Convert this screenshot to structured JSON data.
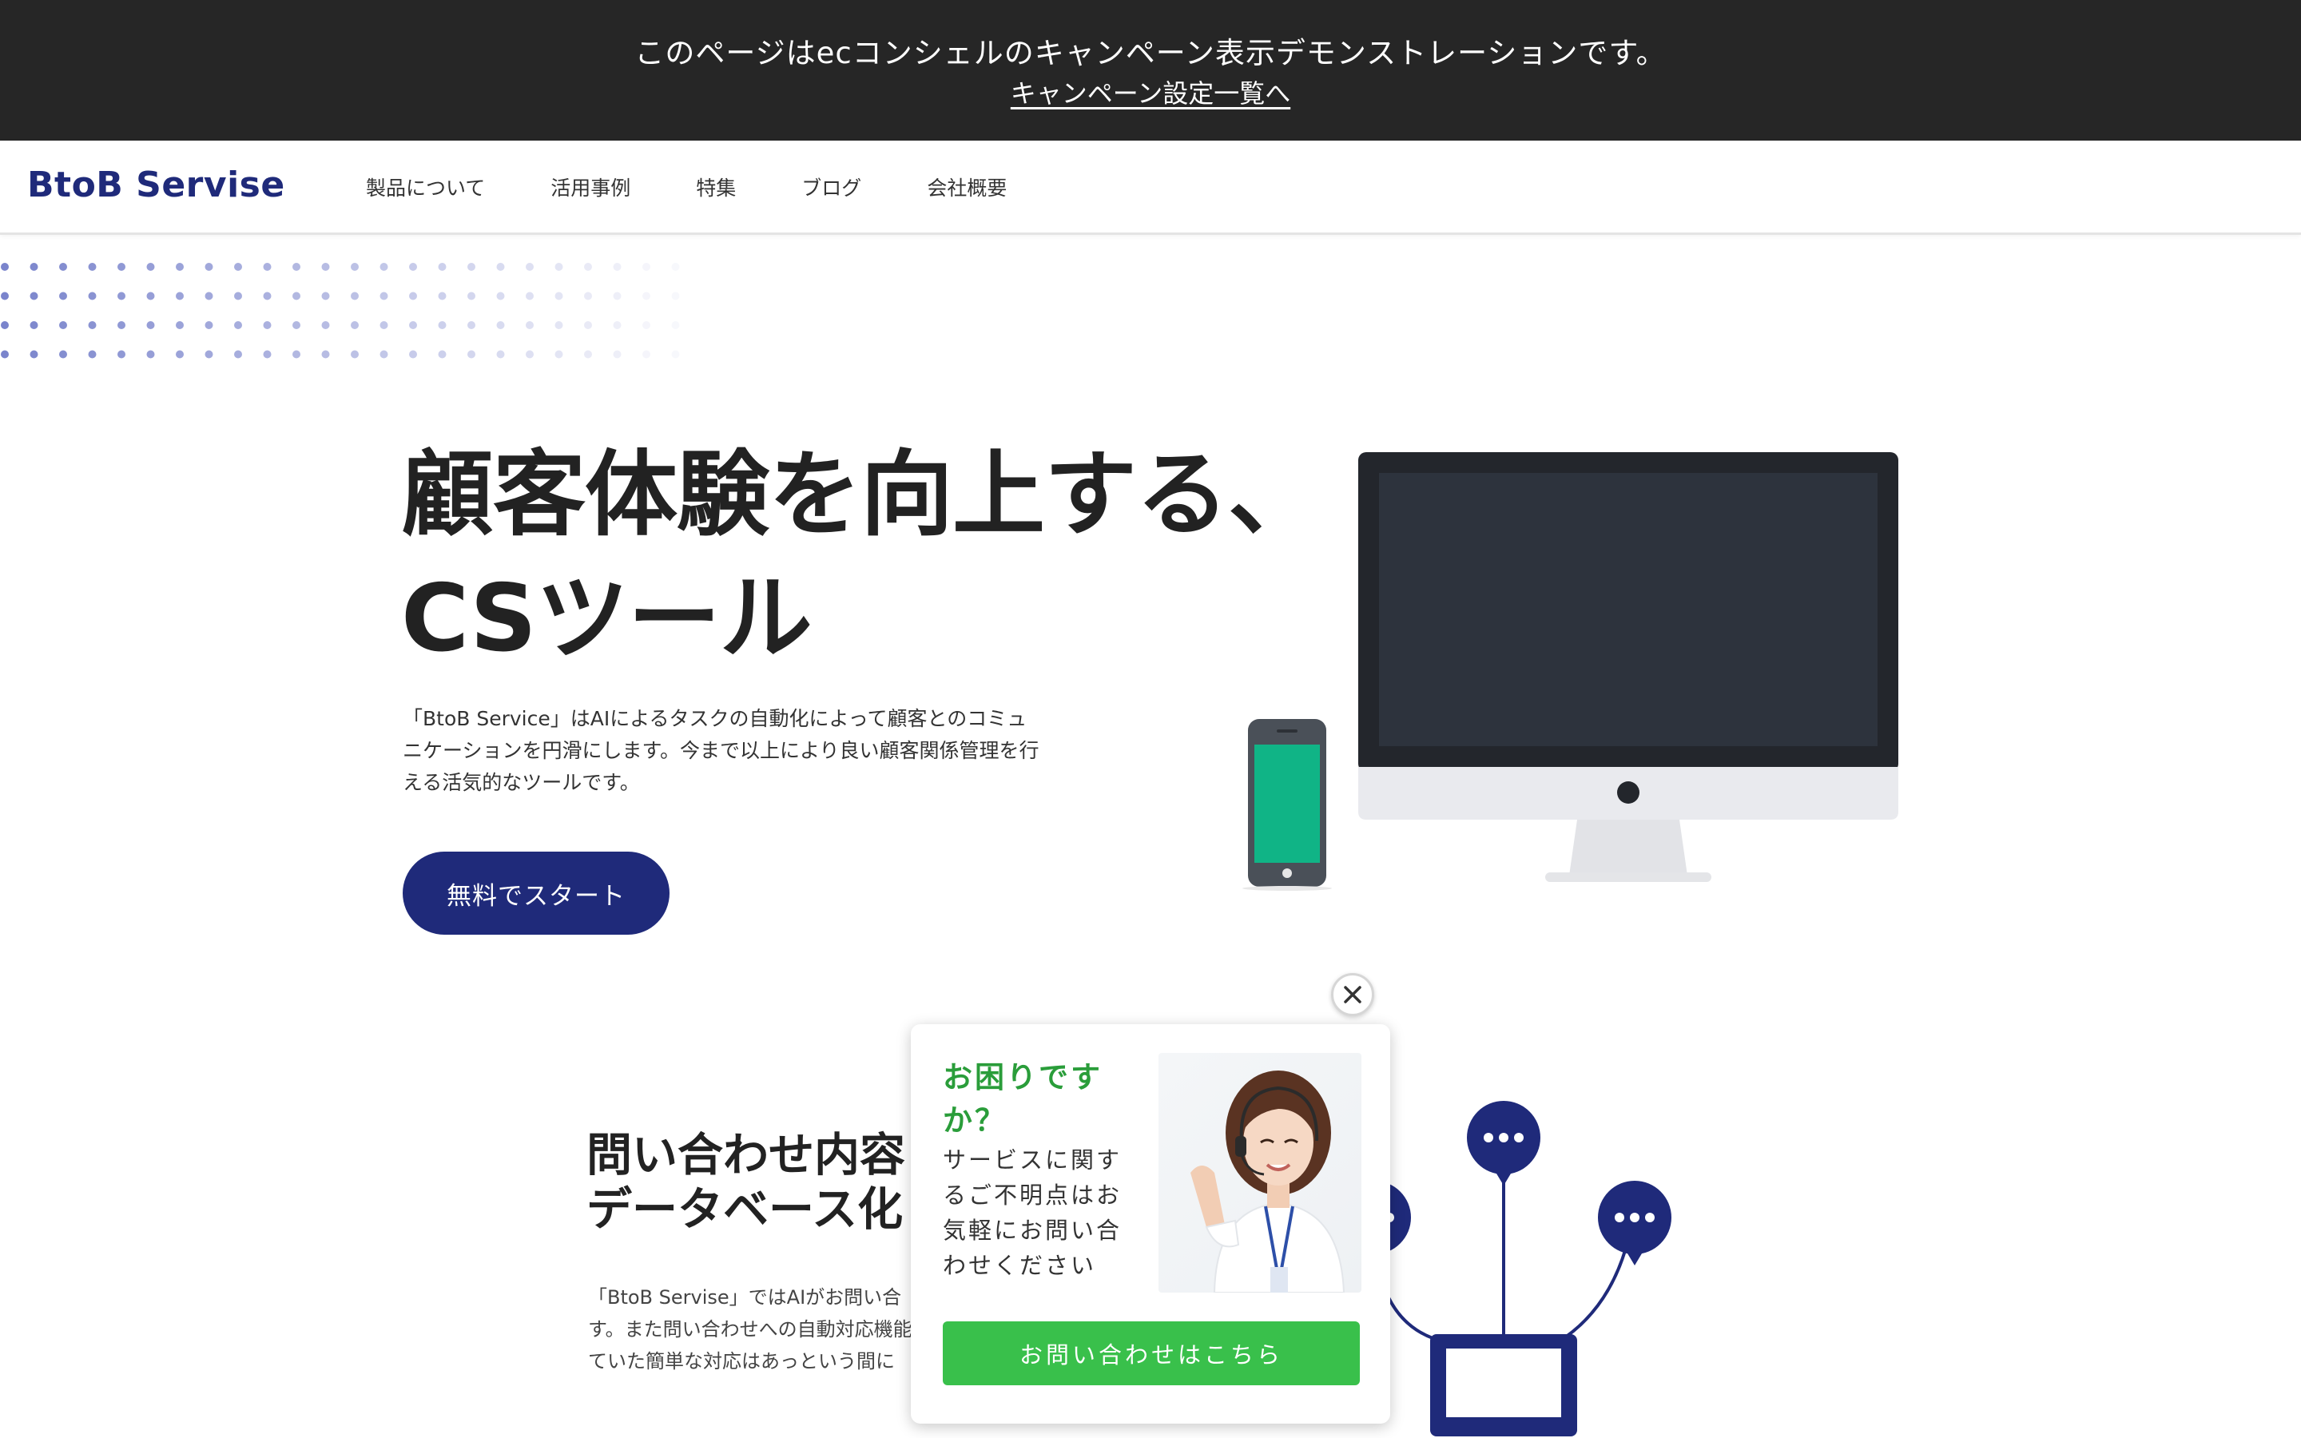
{
  "demo_banner": {
    "text": "このページはecコンシェルのキャンペーン表示デモンストレーションです。",
    "link_label": "キャンペーン設定一覧へ"
  },
  "header": {
    "logo": "BtoB Servise",
    "nav": [
      {
        "label": "製品について"
      },
      {
        "label": "活用事例"
      },
      {
        "label": "特集"
      },
      {
        "label": "ブログ"
      },
      {
        "label": "会社概要"
      }
    ]
  },
  "hero": {
    "title_line1": "顧客体験を向上する、",
    "title_line2": "CSツール",
    "desc_lines": [
      "「BtoB Service」はAIによるタスクの自動化によって顧客とのコミュ",
      "ニケーションを円滑にします。今まで以上により良い顧客関係管理を行",
      "える活気的なツールです。"
    ],
    "cta_label": "無料でスタート"
  },
  "section2": {
    "title_line1": "問い合わせ内容",
    "title_line2": "データベース化",
    "desc_lines": [
      "「BtoB Servise」ではAIがお問い合",
      "す。また問い合わせへの自動対応機能",
      "ていた簡単な対応はあっという間に"
    ]
  },
  "popup": {
    "title": "お困りですか？",
    "body": "サービスに関するご不明点はお気軽にお問い合わせください",
    "cta_label": "お問い合わせはこちら",
    "photo_icon": "support-agent-photo",
    "close_icon": "close-icon"
  },
  "colors": {
    "banner_bg": "#262626",
    "brand_navy": "#1f2a7a",
    "popup_green": "#39c04b",
    "popup_title_green": "#2a9d3a",
    "phone_screen": "#10b486",
    "monitor_screen": "#2d333d"
  }
}
